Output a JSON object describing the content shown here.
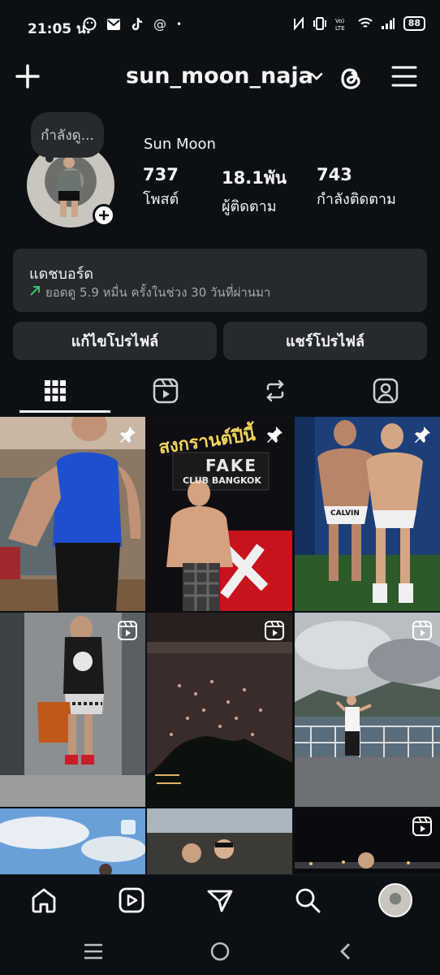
{
  "status_bar": {
    "time": "21:05 น.",
    "at_symbol": "@",
    "dot": "•",
    "battery": "88"
  },
  "header": {
    "username": "sun_moon_naja"
  },
  "profile": {
    "note": "กำลังดู...",
    "display_name": "Sun Moon",
    "stats": {
      "posts_count": "737",
      "posts_label": "โพสต์",
      "followers_count": "18.1พัน",
      "followers_label": "ผู้ติดตาม",
      "following_count": "743",
      "following_label": "กำลังติดตาม"
    }
  },
  "dashboard": {
    "title": "แดชบอร์ด",
    "subtitle": "ยอดดู 5.9 หมื่น ครั้งในช่วง 30 วันที่ผ่านมา"
  },
  "buttons": {
    "edit_profile": "แก้ไขโปรไฟล์",
    "share_profile": "แชร์โปรไฟล์"
  },
  "tabs": [
    {
      "icon": "grid-icon",
      "selected": true
    },
    {
      "icon": "reels-icon",
      "selected": false
    },
    {
      "icon": "repost-icon",
      "selected": false
    },
    {
      "icon": "tagged-icon",
      "selected": false
    }
  ],
  "grid": {
    "post_2_sign_text": "สงกรานต์ปีนี้",
    "post_2_club_name": "FAKE",
    "post_2_club_city": "CLUB BANGKOK",
    "post_3_underwear_text": "CALVIN"
  },
  "colors": {
    "background": "#0c1014",
    "surface": "#26292d",
    "trend_up": "#3cc26e"
  }
}
